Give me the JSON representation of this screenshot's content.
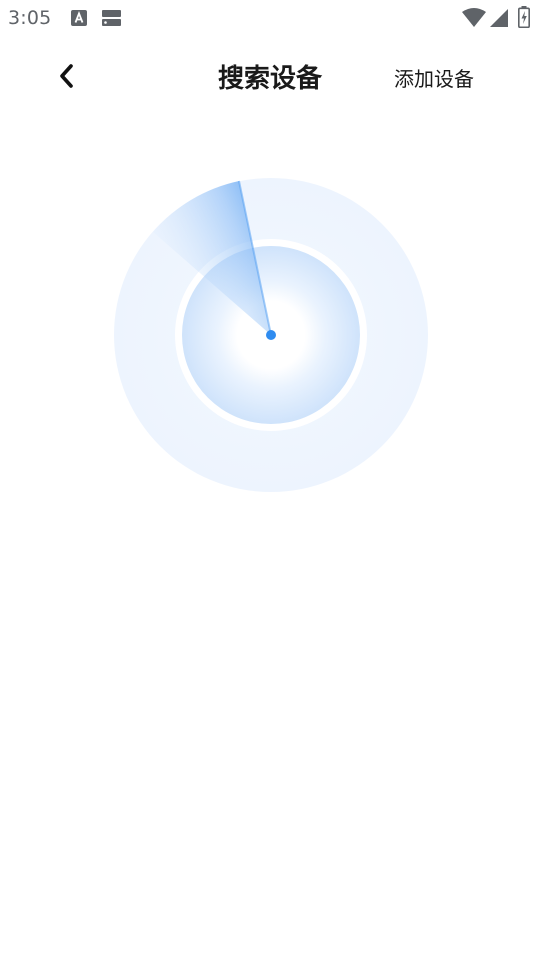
{
  "status_bar": {
    "time": "3:05",
    "icons": [
      "font-a-icon",
      "storage-icon",
      "wifi-icon",
      "signal-icon",
      "battery-charging-icon"
    ]
  },
  "header": {
    "back_icon": "chevron-left-icon",
    "title": "搜索设备",
    "add_device_label": "添加设备"
  },
  "radar": {
    "accent_color": "#2f8cf0",
    "ring_color": "#eef5fe",
    "inner_color": "#d4e6fb",
    "state": "scanning"
  }
}
